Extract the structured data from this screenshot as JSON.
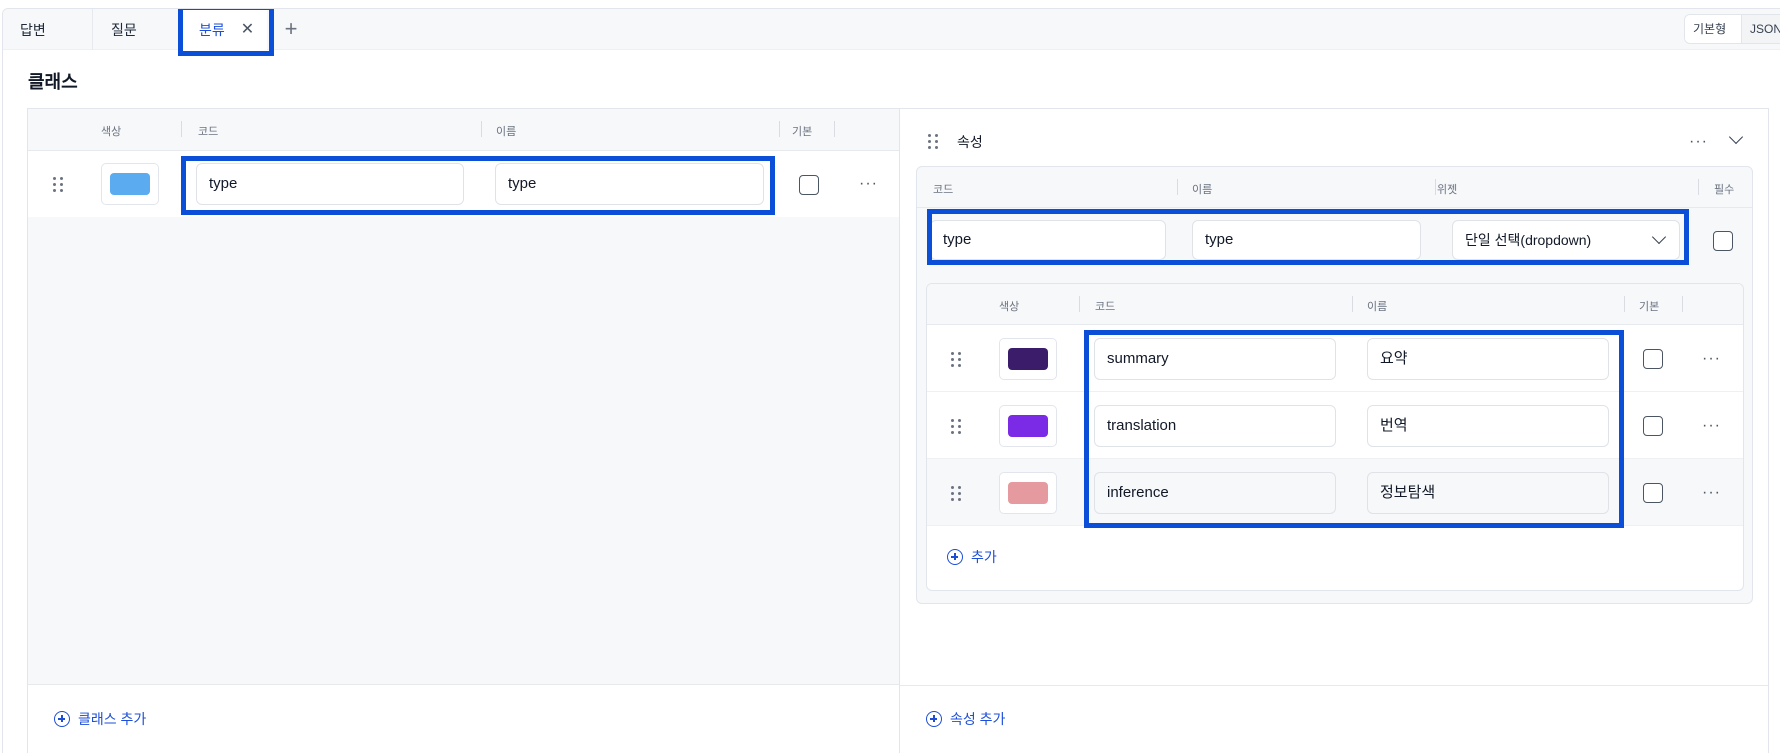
{
  "tabs": [
    {
      "label": "답변"
    },
    {
      "label": "질문"
    },
    {
      "label": "분류"
    }
  ],
  "view_toggle": {
    "options": [
      "기본형식",
      "JSON"
    ],
    "selected": "기본형식"
  },
  "section_title": "클래스",
  "classes": {
    "columns": {
      "color": "색상",
      "code": "코드",
      "name": "이름",
      "default": "기본"
    },
    "rows": [
      {
        "color": "#5aabf0",
        "code": "type",
        "name": "type",
        "default": false
      }
    ],
    "add_label": "클래스 추가"
  },
  "attributes": {
    "title": "속성",
    "columns": {
      "code": "코드",
      "name": "이름",
      "widget": "위젯",
      "required": "필수"
    },
    "item": {
      "code": "type",
      "name": "type",
      "widget": "단일 선택(dropdown)",
      "required": false
    },
    "options": {
      "columns": {
        "color": "색상",
        "code": "코드",
        "name": "이름",
        "default": "기본"
      },
      "rows": [
        {
          "color": "#3b1c6b",
          "code": "summary",
          "name": "요약",
          "default": false
        },
        {
          "color": "#7b2be5",
          "code": "translation",
          "name": "번역",
          "default": false
        },
        {
          "color": "#e49a9e",
          "code": "inference",
          "name": "정보탐색",
          "default": false
        }
      ],
      "add_label": "추가"
    },
    "add_label": "속성 추가"
  }
}
